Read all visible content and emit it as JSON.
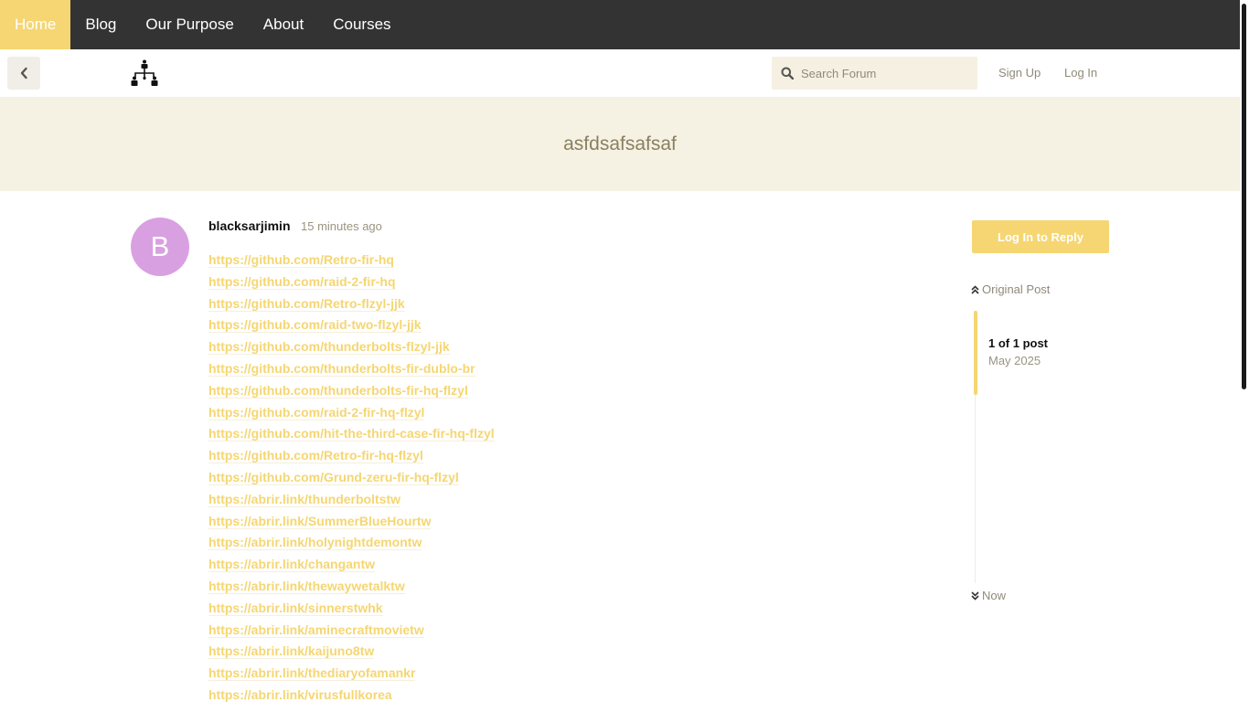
{
  "topnav": {
    "items": [
      {
        "label": "Home",
        "active": true
      },
      {
        "label": "Blog"
      },
      {
        "label": "Our Purpose"
      },
      {
        "label": "About"
      },
      {
        "label": "Courses"
      }
    ]
  },
  "header": {
    "search_placeholder": "Search Forum",
    "signup_label": "Sign Up",
    "login_label": "Log In"
  },
  "topic": {
    "title": "asfdsafsafsaf"
  },
  "post": {
    "avatar_letter": "B",
    "author": "blacksarjimin",
    "time": "15 minutes ago",
    "links": [
      "https://github.com/Retro-fir-hq",
      "https://github.com/raid-2-fir-hq",
      "https://github.com/Retro-flzyl-jjk",
      "https://github.com/raid-two-flzyl-jjk",
      "https://github.com/thunderbolts-flzyl-jjk",
      "https://github.com/thunderbolts-fir-dublo-br",
      "https://github.com/thunderbolts-fir-hq-flzyl",
      "https://github.com/raid-2-fir-hq-flzyl",
      "https://github.com/hit-the-third-case-fir-hq-flzyl",
      "https://github.com/Retro-fir-hq-flzyl",
      "https://github.com/Grund-zeru-fir-hq-flzyl",
      "https://abrir.link/thunderboltstw",
      "https://abrir.link/SummerBlueHourtw",
      "https://abrir.link/holynightdemontw",
      "https://abrir.link/changantw",
      "https://abrir.link/thewaywetalktw",
      "https://abrir.link/sinnerstwhk",
      "https://abrir.link/aminecraftmovietw",
      "https://abrir.link/kaijuno8tw",
      "https://abrir.link/thediaryofamankr",
      "https://abrir.link/virusfullkorea"
    ]
  },
  "sidebar": {
    "reply_label": "Log In to Reply",
    "original_post_label": "Original Post",
    "count_label": "1 of 1 post",
    "date_label": "May 2025",
    "now_label": "Now"
  },
  "colors": {
    "accent": "#f5d672",
    "nav_bg": "#333333",
    "banner_bg": "#f5f1e3",
    "avatar_bg": "#d9a0e1"
  },
  "icons": [
    "chevron-left-icon",
    "sitemap-logo-icon",
    "search-icon",
    "double-chevron-up-icon",
    "double-chevron-down-icon"
  ]
}
